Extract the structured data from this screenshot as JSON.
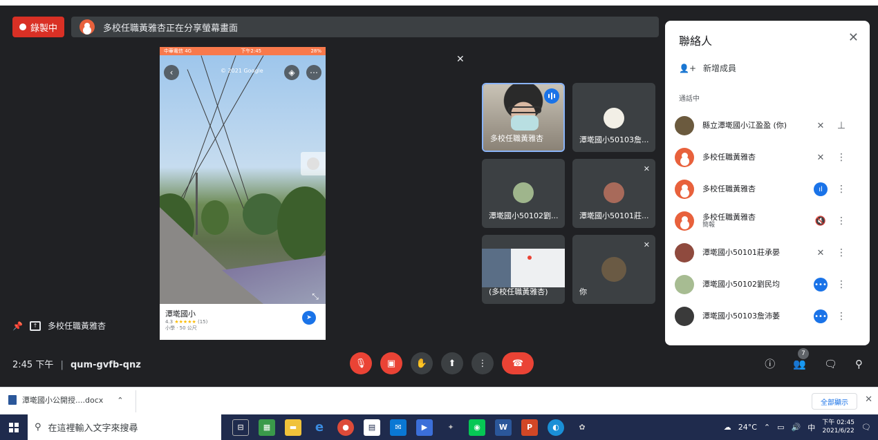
{
  "recording": {
    "label": "錄製中"
  },
  "share_banner": {
    "text": "多校任職黃雅杏正在分享螢幕畫面"
  },
  "shared_screen": {
    "status_left": "中華電信 4G",
    "status_time": "下午2:45",
    "status_right": "28%",
    "google_text": "© 2021 Google",
    "place_name": "潭墘國小",
    "place_rating_value": "4.3",
    "place_stars": "★★★★★",
    "place_reviews": "(15)",
    "place_sub": "小學 · 50 公尺"
  },
  "tiles": [
    {
      "label": "多校任職黃雅杏"
    },
    {
      "label": "潭墘國小50103詹..."
    },
    {
      "label": "潭墘國小50102劉..."
    },
    {
      "label": "潭墘國小50101莊..."
    },
    {
      "label": "(多校任職黃雅杏)"
    },
    {
      "label": "你"
    }
  ],
  "pinned": {
    "label": "多校任職黃雅杏"
  },
  "meeting": {
    "time": "2:45 下午",
    "separator": "|",
    "code": "qum-gvfb-qnz"
  },
  "people_count": "7",
  "panel": {
    "title": "聯絡人",
    "add_member": "新增成員",
    "in_call": "通話中",
    "people": [
      {
        "name": "縣立潭墘國小江盈盈 (你)",
        "sub": ""
      },
      {
        "name": "多校任職黃雅杏",
        "sub": ""
      },
      {
        "name": "多校任職黃雅杏",
        "sub": ""
      },
      {
        "name": "多校任職黃雅杏",
        "sub": "簡報"
      },
      {
        "name": "潭墘國小50101莊承晏",
        "sub": ""
      },
      {
        "name": "潭墘國小50102劉民均",
        "sub": ""
      },
      {
        "name": "潭墘國小50103詹沛萎",
        "sub": ""
      }
    ]
  },
  "download": {
    "file": "潭墘國小公開授....docx",
    "show_all": "全部顯示"
  },
  "taskbar": {
    "search_placeholder": "在這裡輸入文字來搜尋",
    "weather": "24°C",
    "ime": "中",
    "clock_time": "下午 02:45",
    "clock_date": "2021/6/22"
  },
  "colors": {
    "meet_bg": "#202124",
    "accent": "#1a73e8",
    "danger": "#ea4335",
    "taskbar": "#1f2b4d"
  }
}
